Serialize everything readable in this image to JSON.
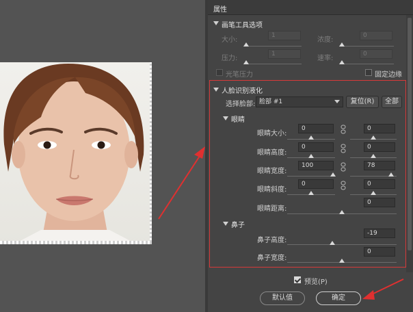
{
  "panel": {
    "title": "属性",
    "brush_section": {
      "label": "画笔工具选项",
      "size_label": "大小:",
      "size_value": "1",
      "density_label": "浓度:",
      "density_value": "0",
      "pressure_label": "压力:",
      "pressure_value": "1",
      "rate_label": "速率:",
      "rate_value": "0",
      "stylus_label": "光笔压力",
      "pin_edges_label": "固定边缘"
    },
    "face_section": {
      "label": "人脸识别液化",
      "select_face_label": "选择脸部:",
      "select_face_value": "脸部 #1",
      "reset_label": "复位(R)",
      "all_label": "全部",
      "eyes_label": "眼睛",
      "eye_size_label": "眼睛大小:",
      "eye_size_left": "0",
      "eye_size_right": "0",
      "eye_height_label": "眼睛高度:",
      "eye_height_left": "0",
      "eye_height_right": "0",
      "eye_width_label": "眼睛宽度:",
      "eye_width_left": "100",
      "eye_width_right": "78",
      "eye_tilt_label": "眼睛斜度:",
      "eye_tilt_left": "0",
      "eye_tilt_right": "0",
      "eye_distance_label": "眼睛距离:",
      "eye_distance_value": "0",
      "nose_label": "鼻子",
      "nose_height_label": "鼻子高度:",
      "nose_height_value": "-19",
      "nose_width_label": "鼻子宽度:",
      "nose_width_value": "0"
    },
    "preview_label": "预览(P)",
    "default_button": "默认值",
    "ok_button": "确定"
  },
  "colors": {
    "panel_bg": "#444444",
    "canvas_bg": "#535353",
    "highlight_box": "#d83a3a",
    "arrow": "#e03030"
  }
}
